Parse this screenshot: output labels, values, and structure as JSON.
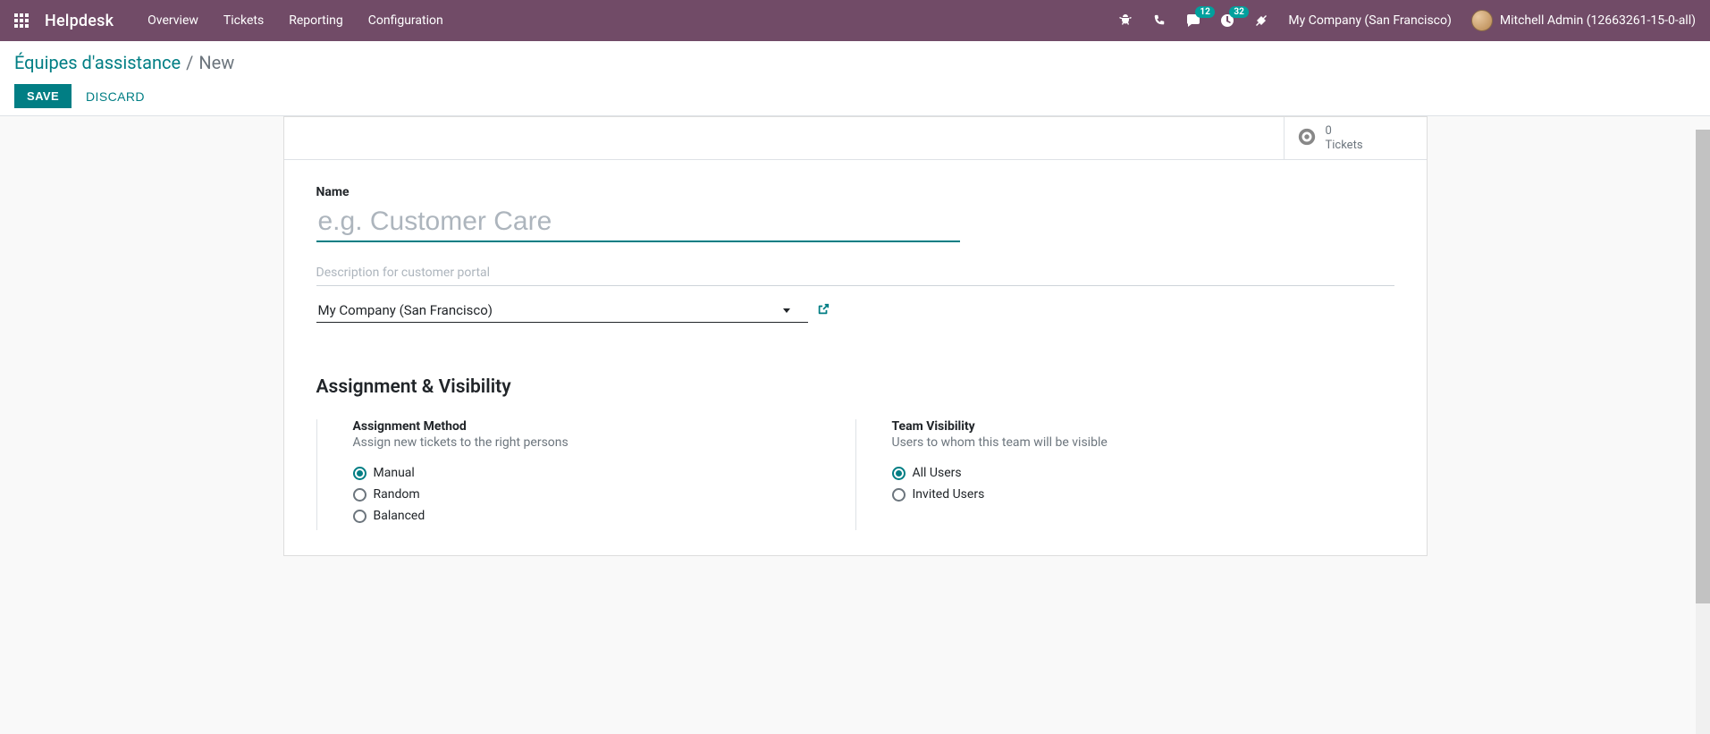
{
  "navbar": {
    "brand": "Helpdesk",
    "links": [
      "Overview",
      "Tickets",
      "Reporting",
      "Configuration"
    ],
    "messaging_badge": "12",
    "activities_badge": "32",
    "company": "My Company (San Francisco)",
    "user": "Mitchell Admin (12663261-15-0-all)"
  },
  "breadcrumb": {
    "parent": "Équipes d'assistance",
    "sep": "/",
    "current": "New"
  },
  "buttons": {
    "save": "SAVE",
    "discard": "DISCARD"
  },
  "stat": {
    "value": "0",
    "label": "Tickets"
  },
  "form": {
    "name_label": "Name",
    "name_placeholder": "e.g. Customer Care",
    "name_value": "",
    "description_placeholder": "Description for customer portal",
    "company_value": "My Company (San Francisco)"
  },
  "section": {
    "title": "Assignment & Visibility",
    "assignment": {
      "heading": "Assignment Method",
      "sub": "Assign new tickets to the right persons",
      "options": [
        "Manual",
        "Random",
        "Balanced"
      ],
      "selected": "Manual"
    },
    "visibility": {
      "heading": "Team Visibility",
      "sub": "Users to whom this team will be visible",
      "options": [
        "All Users",
        "Invited Users"
      ],
      "selected": "All Users"
    }
  }
}
